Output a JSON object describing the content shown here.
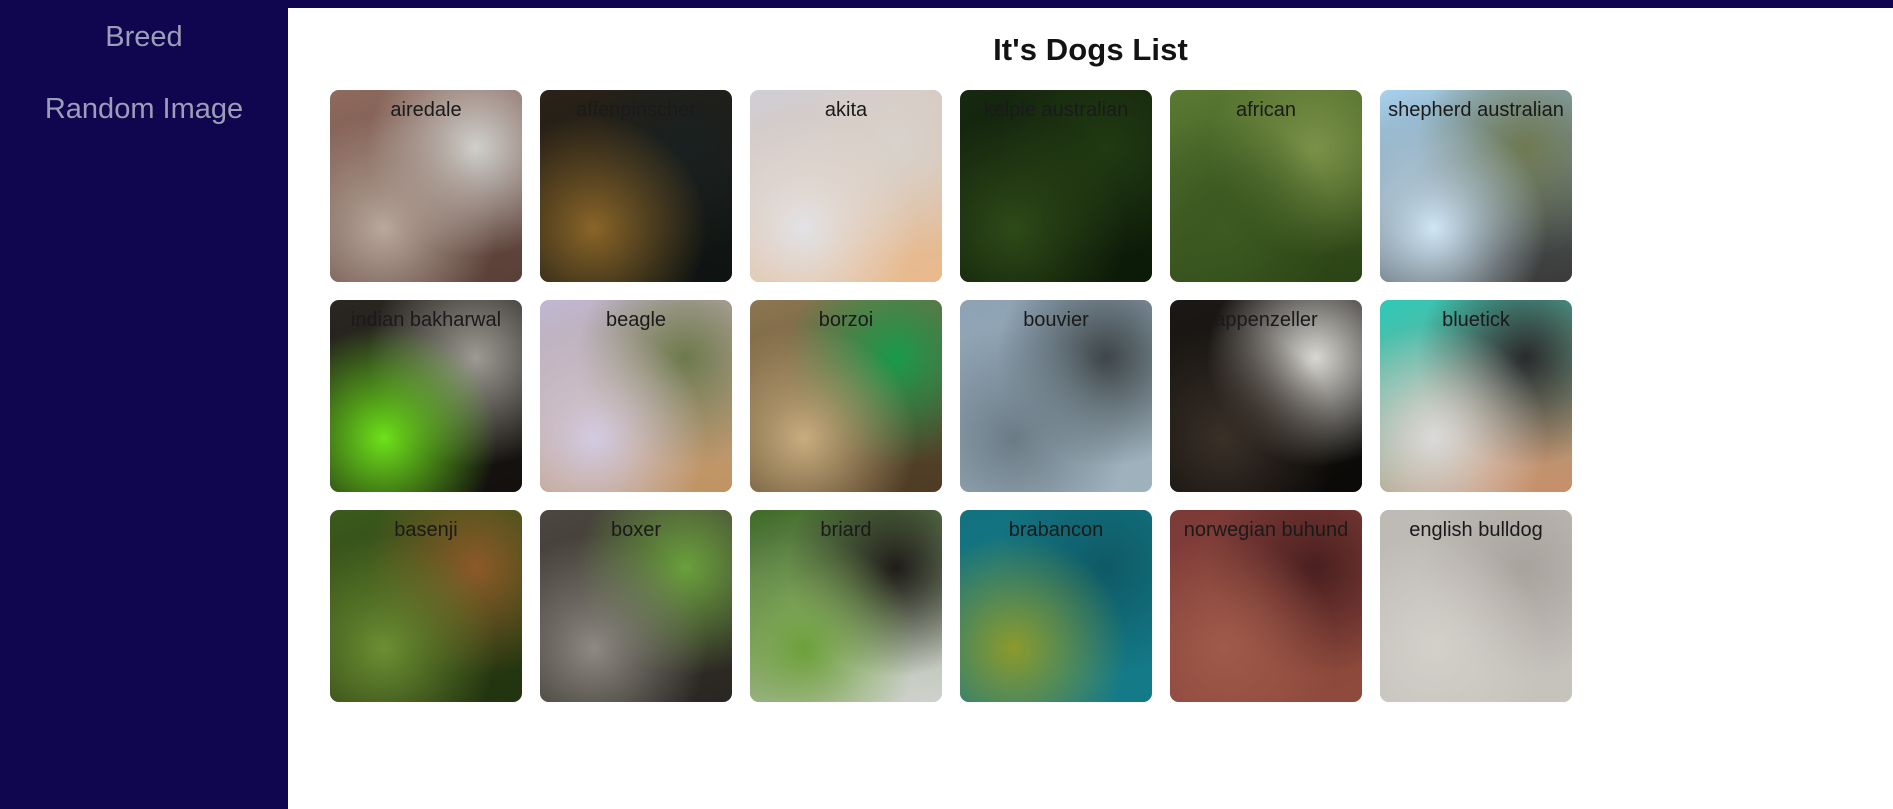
{
  "sidebar": {
    "items": [
      {
        "label": "Breed",
        "name": "sidebar-link-breed"
      },
      {
        "label": "Random Image",
        "name": "sidebar-link-random-image"
      }
    ],
    "background_color": "#100650",
    "link_color": "#9d9db8"
  },
  "header": {
    "title": "It's Dogs List"
  },
  "scrollbar": {
    "track_color": "#f1f1f1",
    "thumb_color": "#c1c1c1",
    "up_arrow_icon": "triangle-up-icon"
  },
  "grid": {
    "columns": 6,
    "cards": [
      {
        "label": "airedale",
        "colors": [
          "#8f6a5e",
          "#b9a89c",
          "#cfcfcb",
          "#5a4038"
        ]
      },
      {
        "label": "affenpinscher",
        "colors": [
          "#2b2218",
          "#8a6528",
          "#1a2020",
          "#0e1412"
        ]
      },
      {
        "label": "akita",
        "colors": [
          "#cfcfd6",
          "#e2e2e6",
          "#d8d2cc",
          "#e8b98c"
        ]
      },
      {
        "label": "kelpie australian",
        "colors": [
          "#16280f",
          "#2f4a18",
          "#213a12",
          "#0c1a08"
        ]
      },
      {
        "label": "african",
        "colors": [
          "#5a7a33",
          "#3d5a22",
          "#7a9148",
          "#2c4415"
        ]
      },
      {
        "label": "shepherd australian",
        "colors": [
          "#a9d2ee",
          "#cfe6f6",
          "#6f7a52",
          "#3a3a38"
        ]
      },
      {
        "label": "indian bakharwal",
        "colors": [
          "#2a2622",
          "#6ee21a",
          "#9c9a92",
          "#13100e"
        ]
      },
      {
        "label": "beagle",
        "colors": [
          "#bfb8d4",
          "#d2cbe2",
          "#6d7a4c",
          "#c09462"
        ]
      },
      {
        "label": "borzoi",
        "colors": [
          "#8d7752",
          "#c8ad7e",
          "#1a9a4a",
          "#4d3b24"
        ]
      },
      {
        "label": "bouvier",
        "colors": [
          "#8da2b4",
          "#6b7b86",
          "#3e4648",
          "#9fb2bd"
        ]
      },
      {
        "label": "appenzeller",
        "colors": [
          "#1b1815",
          "#3a3028",
          "#d9d7d2",
          "#0c0a08"
        ]
      },
      {
        "label": "bluetick",
        "colors": [
          "#2ec9b8",
          "#dadada",
          "#2a2a2c",
          "#c98f6a"
        ]
      },
      {
        "label": "basenji",
        "colors": [
          "#3c5a1c",
          "#6d8f32",
          "#8c5a28",
          "#22330f"
        ]
      },
      {
        "label": "boxer",
        "colors": [
          "#4c4740",
          "#8e8a82",
          "#6aa03c",
          "#2a2622"
        ]
      },
      {
        "label": "briard",
        "colors": [
          "#3e6a24",
          "#6da03a",
          "#1f1c18",
          "#cfd2cc"
        ]
      },
      {
        "label": "brabancon",
        "colors": [
          "#13727f",
          "#8c9a2c",
          "#0e5a66",
          "#157a88"
        ]
      },
      {
        "label": "norwegian buhund",
        "colors": [
          "#7c3a38",
          "#a05a4a",
          "#4a1f20",
          "#8e4a3c"
        ]
      },
      {
        "label": "english bulldog",
        "colors": [
          "#bdb9b4",
          "#d3cfc9",
          "#a8a39d",
          "#c6c2bc"
        ]
      }
    ]
  }
}
